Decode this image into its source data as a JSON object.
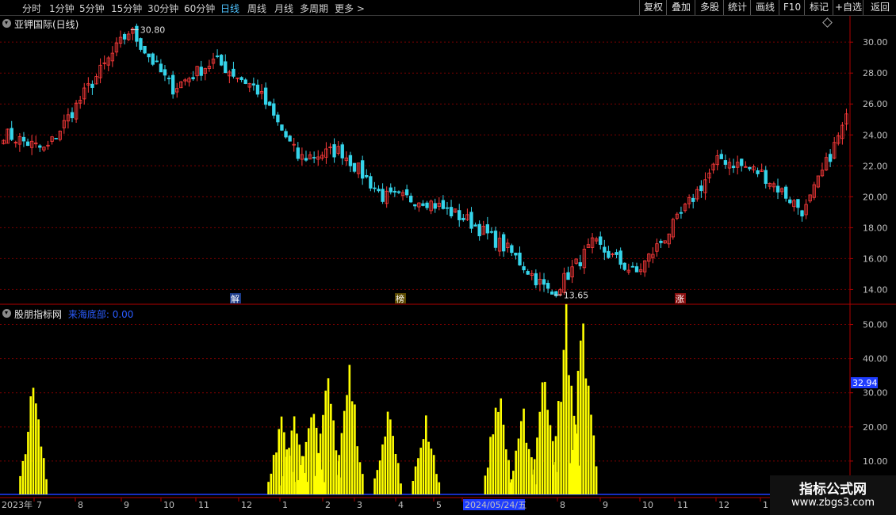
{
  "toolbar": {
    "periods": [
      "分时",
      "1分钟",
      "5分钟",
      "15分钟",
      "30分钟",
      "60分钟",
      "日线",
      "周线",
      "月线",
      "多周期",
      "更多"
    ],
    "active_period": "日线",
    "right_buttons": [
      "复权",
      "叠加",
      "多股",
      "统计",
      "画线",
      "F10",
      "标记",
      "+自选",
      "返回"
    ]
  },
  "stock": {
    "title": "亚钾国际(日线)"
  },
  "indicator": {
    "source": "股朋指标网",
    "name": "来海底部:",
    "value": "0.00",
    "current_readout": "32.94"
  },
  "price_axis": {
    "ticks": [
      "30.00",
      "28.00",
      "26.00",
      "24.00",
      "22.00",
      "20.00",
      "18.00",
      "16.00",
      "14.00"
    ],
    "range": [
      13.1,
      31.7
    ]
  },
  "ind_axis": {
    "ticks": [
      "50.00",
      "40.00",
      "30.00",
      "20.00",
      "10.00"
    ],
    "range": [
      0,
      55
    ]
  },
  "date_axis": {
    "labels": [
      "2023年",
      "7",
      "8",
      "9",
      "10",
      "11",
      "12",
      "1",
      "2",
      "3",
      "4",
      "5",
      "2024/05/24/五",
      "8",
      "9",
      "10",
      "11",
      "12",
      "1"
    ]
  },
  "annotations": {
    "high_label": "30.80",
    "low_label": "13.65"
  },
  "markers": [
    "解",
    "榜",
    "涨"
  ],
  "watermark": {
    "line1": "指标公式网",
    "line2": "www.zbgs3.com"
  },
  "colors": {
    "up": "#ff3b3b",
    "down": "#35d4ea",
    "indicator": "#ffff00",
    "accent_blue": "#1e3cff",
    "grid": "#7a0000",
    "frame": "#b00000"
  },
  "chart_data": {
    "type": "candlestick",
    "title": "亚钾国际(日线)",
    "price_key_points": [
      {
        "t": "2023-06 start",
        "close": 24.1
      },
      {
        "t": "2023-07",
        "close": 23.0
      },
      {
        "t": "2023-08",
        "close": 27.0
      },
      {
        "t": "2023-09 high",
        "close": 30.8
      },
      {
        "t": "2023-10",
        "close": 27.0
      },
      {
        "t": "2023-11",
        "close": 28.8
      },
      {
        "t": "2023-12",
        "close": 27.0
      },
      {
        "t": "2024-01",
        "close": 22.5
      },
      {
        "t": "2024-02",
        "close": 23.0
      },
      {
        "t": "2024-03",
        "close": 20.0
      },
      {
        "t": "2024-04",
        "close": 19.8
      },
      {
        "t": "2024-05",
        "close": 18.5
      },
      {
        "t": "2024-06",
        "close": 16.5
      },
      {
        "t": "2024-07 low",
        "close": 13.65
      },
      {
        "t": "2024-08",
        "close": 17.0
      },
      {
        "t": "2024-09",
        "close": 15.0
      },
      {
        "t": "2024-10",
        "close": 18.5
      },
      {
        "t": "2024-11",
        "close": 22.5
      },
      {
        "t": "2024-12",
        "close": 21.5
      },
      {
        "t": "2025-01",
        "close": 19.0
      },
      {
        "t": "2025-02",
        "close": 25.0
      }
    ],
    "indicator_series": {
      "name": "来海底部",
      "bursts": [
        {
          "center": 0.038,
          "peak": 32
        },
        {
          "center": 0.33,
          "peak": 25
        },
        {
          "center": 0.345,
          "peak": 22
        },
        {
          "center": 0.365,
          "peak": 30
        },
        {
          "center": 0.385,
          "peak": 34
        },
        {
          "center": 0.41,
          "peak": 38
        },
        {
          "center": 0.455,
          "peak": 27
        },
        {
          "center": 0.5,
          "peak": 24
        },
        {
          "center": 0.585,
          "peak": 32
        },
        {
          "center": 0.615,
          "peak": 24
        },
        {
          "center": 0.64,
          "peak": 38
        },
        {
          "center": 0.665,
          "peak": 53
        },
        {
          "center": 0.685,
          "peak": 52
        }
      ]
    },
    "ylim_price": [
      13.1,
      31.7
    ],
    "ylim_indicator": [
      0,
      55
    ]
  }
}
